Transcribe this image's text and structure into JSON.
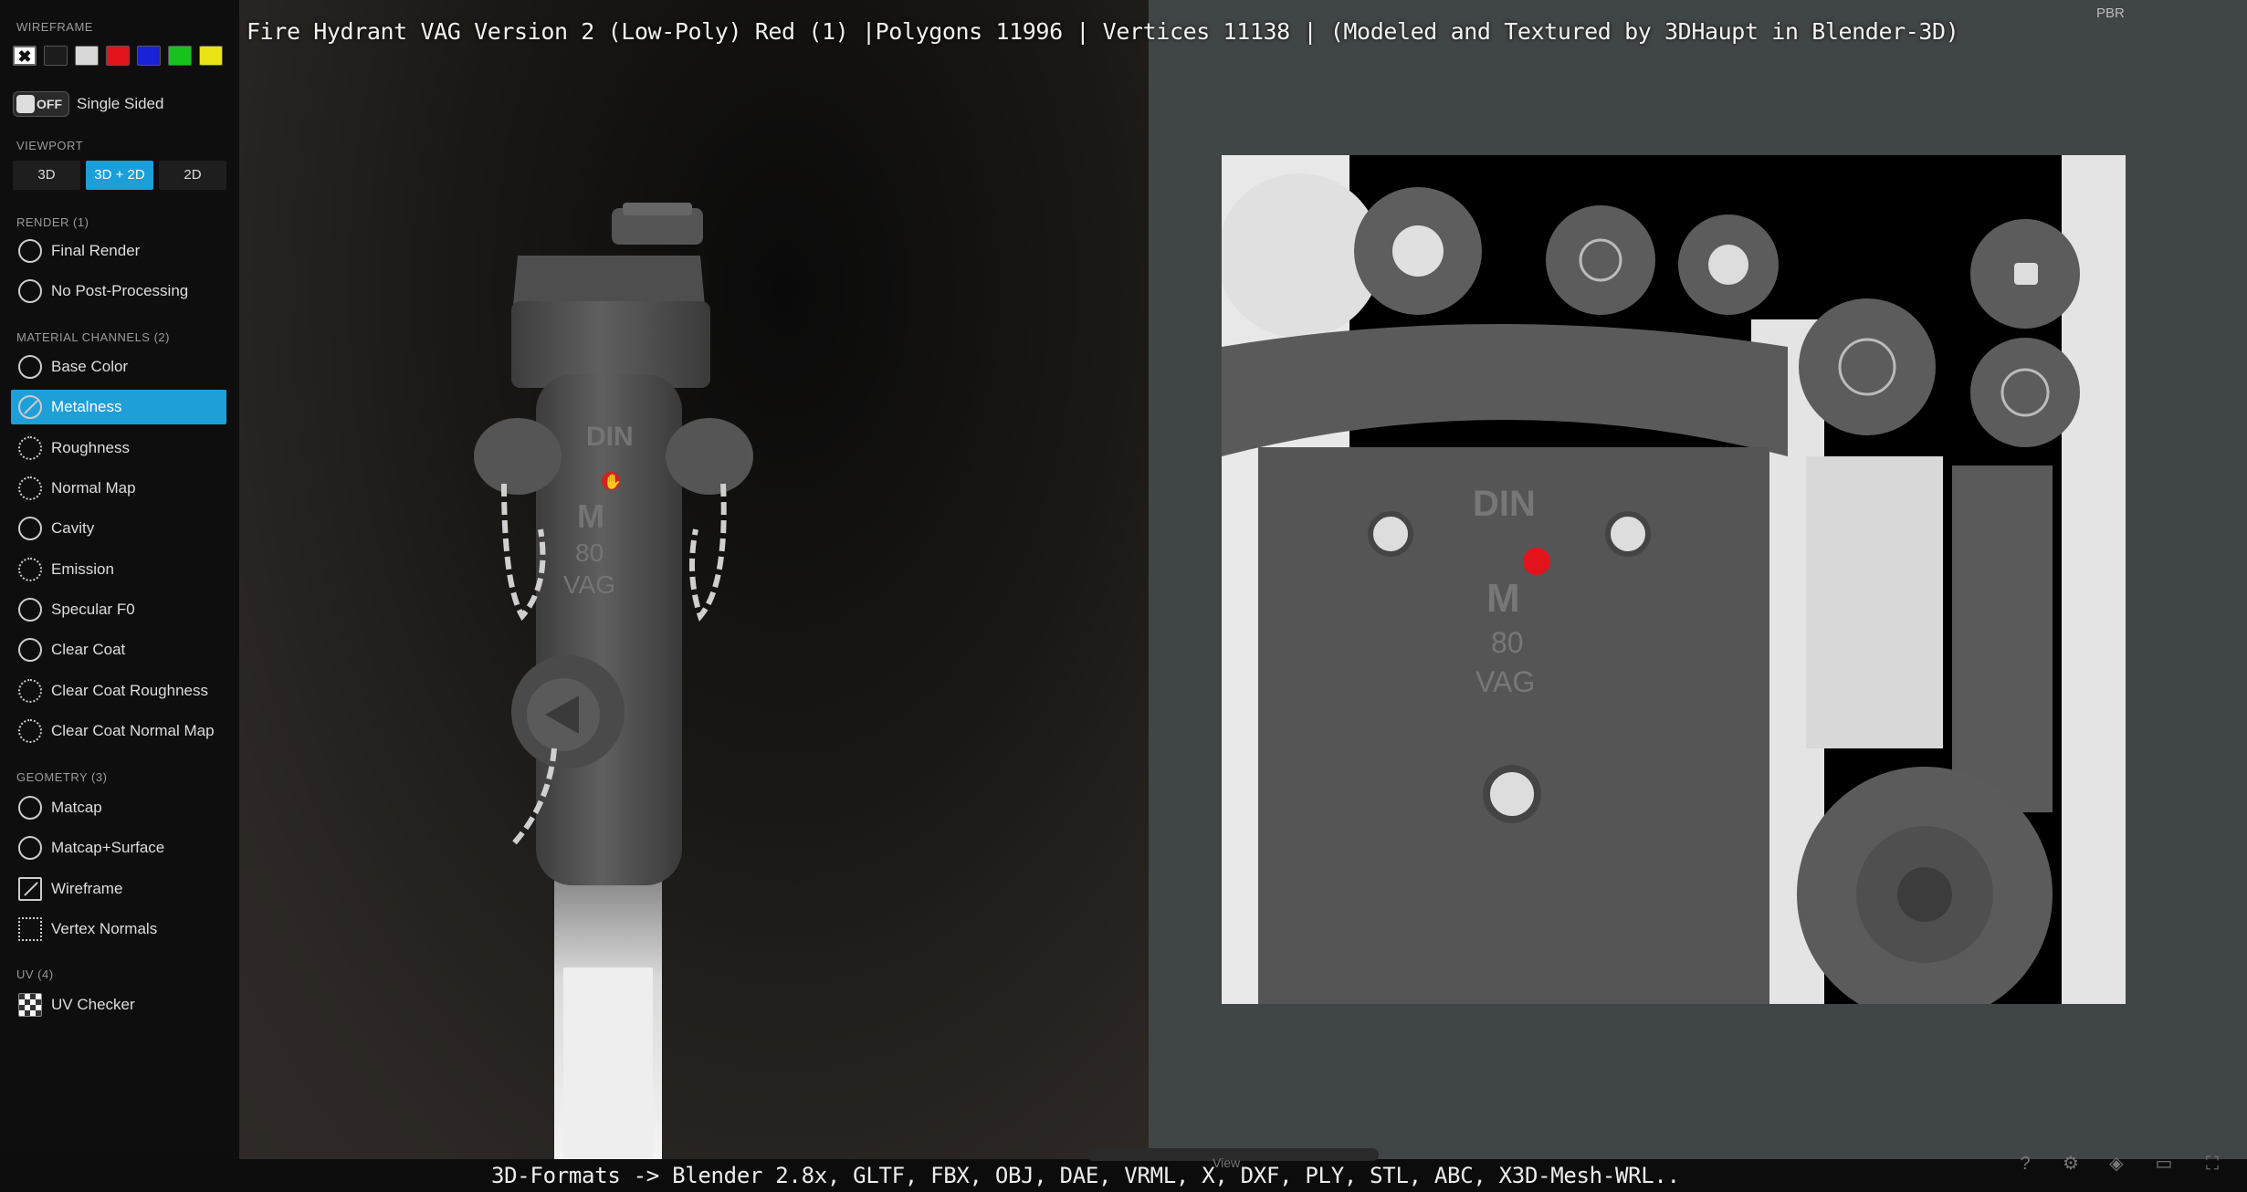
{
  "title": "Fire Hydrant VAG Version 2 (Low-Poly) Red (1) |Polygons 11996 | Vertices 11138 | (Modeled and Textured by 3DHaupt in Blender-3D)",
  "bottom_text": "3D-Formats -> Blender 2.8x, GLTF, FBX, OBJ, DAE, VRML, X, DXF, PLY, STL, ABC, X3D-Mesh-WRL..",
  "pbr_label": "PBR",
  "view_label": "View",
  "sidebar": {
    "wireframe_header": "WIREFRAME",
    "wireframe_colors": [
      "#ffffff",
      "#1c1c1c",
      "#d8d8d8",
      "#e3131b",
      "#1a22d6",
      "#17c21c",
      "#e8e416"
    ],
    "single_sided": {
      "toggle": "OFF",
      "label": "Single Sided"
    },
    "viewport_header": "VIEWPORT",
    "viewport_buttons": [
      "3D",
      "3D + 2D",
      "2D"
    ],
    "viewport_active": "3D + 2D",
    "render_header": "RENDER (1)",
    "render_items": [
      "Final Render",
      "No Post-Processing"
    ],
    "material_header": "MATERIAL CHANNELS (2)",
    "material_items": [
      "Base Color",
      "Metalness",
      "Roughness",
      "Normal Map",
      "Cavity",
      "Emission",
      "Specular F0",
      "Clear Coat",
      "Clear Coat Roughness",
      "Clear Coat Normal Map"
    ],
    "material_active": "Metalness",
    "geometry_header": "GEOMETRY (3)",
    "geometry_items": [
      "Matcap",
      "Matcap+Surface",
      "Wireframe",
      "Vertex Normals"
    ],
    "uv_header": "UV (4)",
    "uv_items": [
      "UV Checker"
    ]
  },
  "hydrant_markings": [
    "DIN",
    "M",
    "80",
    "VAG"
  ],
  "accent_color": "#1f9fd8",
  "marker_color": "#e3131b"
}
